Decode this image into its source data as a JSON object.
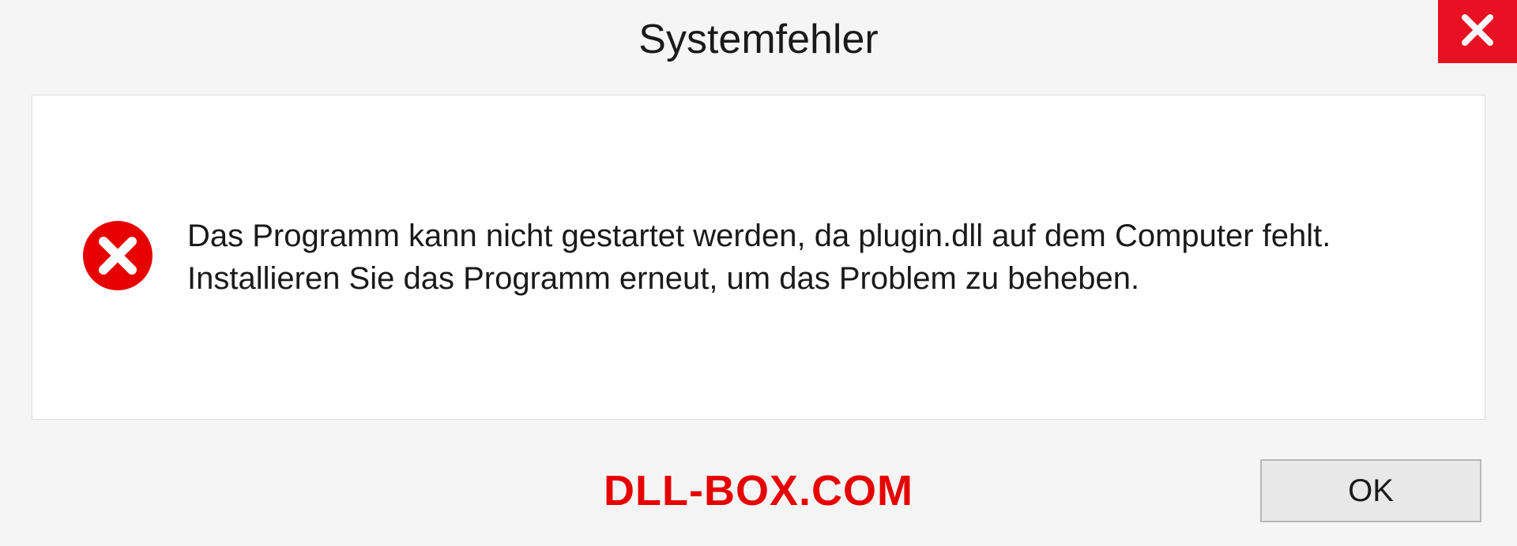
{
  "dialog": {
    "title": "Systemfehler",
    "message": "Das Programm kann nicht gestartet werden, da plugin.dll auf dem Computer fehlt. Installieren Sie das Programm erneut, um das Problem zu beheben.",
    "ok_label": "OK"
  },
  "watermark": "DLL-BOX.COM"
}
